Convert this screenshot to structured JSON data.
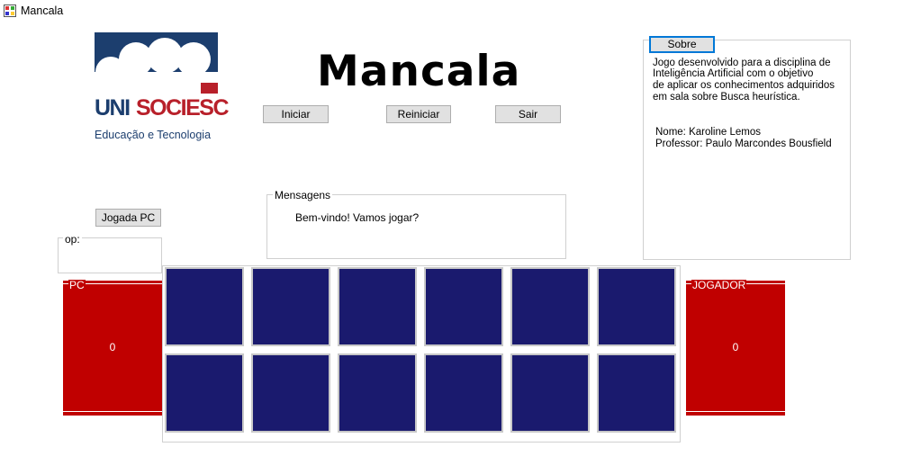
{
  "window": {
    "title": "Mancala"
  },
  "logo": {
    "brand_part1": "UNI",
    "brand_part2": "SOCIESC",
    "tagline": "Educação e Tecnologia"
  },
  "header": {
    "title": "Mancala"
  },
  "buttons": {
    "iniciar": "Iniciar",
    "reiniciar": "Reiniciar",
    "sair": "Sair",
    "jogada_pc": "Jogada PC",
    "sobre": "Sobre"
  },
  "about": {
    "lines": [
      "Jogo desenvolvido para a disciplina de",
      "Inteligência Artificial com o objetivo",
      "de aplicar os conhecimentos adquiridos",
      "em sala sobre Busca heurística."
    ],
    "name_line": "Nome: Karoline Lemos",
    "professor_line": "Professor: Paulo Marcondes Bousfield"
  },
  "messages": {
    "legend": "Mensagens",
    "text": "Bem-vindo! Vamos jogar?"
  },
  "op": {
    "legend": "op:"
  },
  "stores": {
    "pc": {
      "label": "PC",
      "value": "0"
    },
    "jogador": {
      "label": "JOGADOR",
      "value": "0"
    }
  },
  "colors": {
    "pit": "#1a1a6e",
    "store": "#c00000",
    "accent": "#0078d7",
    "brand_blue": "#1c3e6e",
    "brand_red": "#b8202a"
  }
}
